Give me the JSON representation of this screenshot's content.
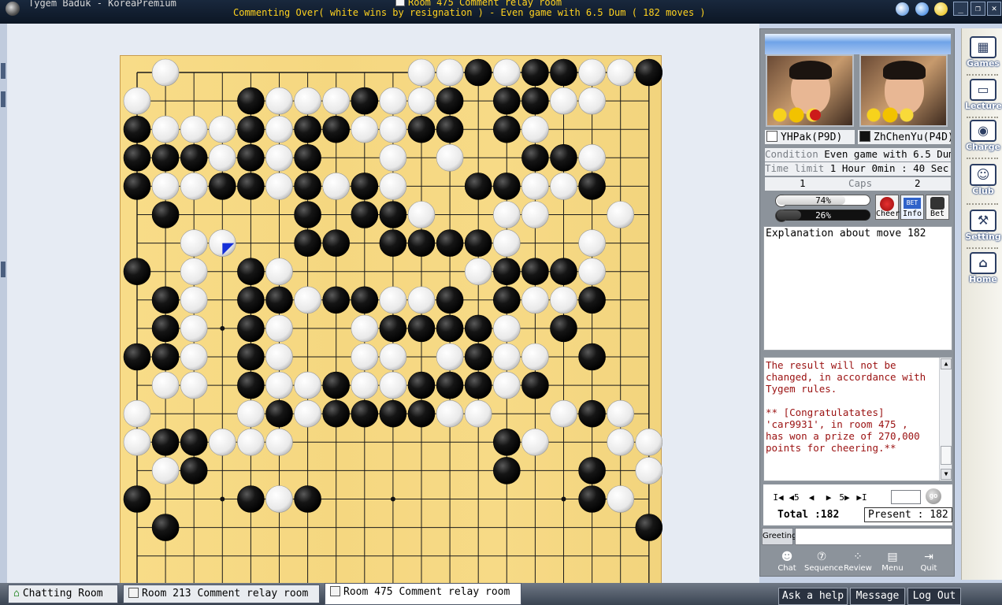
{
  "window": {
    "app_title": "Tygem Baduk - KoreaPremium",
    "room_title": "Room 475 Comment relay room",
    "status": "Commenting Over( white wins by resignation ) - Even game with 6.5 Dum  ( 182 moves )"
  },
  "colors": {
    "board": "#f5d780",
    "title_text": "#ffd21f",
    "chat_text": "#9a1010",
    "last_move_marker": "#1530d8"
  },
  "board": {
    "size": 19,
    "last_move": [
      3,
      6
    ],
    "rows": [
      ".W........WWBWBBWWBW",
      "W...BWWWBWWB.BBWW..",
      "BWWWBWBBWWBB.BW....",
      "BBBWBWB..W.W..BBW..",
      "BWWBBWBWBW..BBWWB..",
      ".B....B.BBW..WW..W.",
      "..WW..BB.BBBBW..W..",
      "B.W.BW......WBBBW..",
      ".BW.BBWBBWWB.BWWB..",
      ".BW.BW..WBBBBW.B...",
      "BBW.BW..WW.WBWW.B..",
      ".WW.BWWBWWBBBWB....",
      "W...WBWBBBBWW..WBW.",
      "WBBWWW.......BW..WWB",
      ".WB..........B..B.WW",
      "B...BWB.........BW..",
      ".B................BB",
      "...................",
      "..................."
    ]
  },
  "players": {
    "white": {
      "name": "YHPak(P9D)"
    },
    "black": {
      "name": "ZhChenYu(P4D)"
    }
  },
  "game_info": {
    "condition_label": "Condition",
    "condition_value": "Even game with 6.5 Dum",
    "time_label": "Time limit",
    "time_value": "1 Hour 0min : 40 Sec / 3 times",
    "caps_label": "Caps",
    "caps_white": "1",
    "caps_black": "2"
  },
  "cheer": {
    "white_pct": 74,
    "black_pct": 26,
    "white_label": "74%",
    "black_label": "26%",
    "cheer_label": "Cheer",
    "info_label": "Info",
    "bet_label": "Bet",
    "bet_badge": "BET"
  },
  "explanation": "Explanation about move 182",
  "chat": "The result will not be\nchanged, in accordance with\nTygem rules.\n\n** [Congratulatates]\n'car9931', in room 475 ,\nhas won a prize of 270,000\npoints for cheering.**",
  "navigation": {
    "first": "I◀",
    "back5": "◀5",
    "back": "◀",
    "forward": "▶",
    "forward5": "5▶",
    "last": "▶I",
    "go_label": "go",
    "total_label": "Total :182",
    "present_label": "Present : 182"
  },
  "greeting": {
    "button": "Greeting"
  },
  "tools": [
    "Chat",
    "Sequence",
    "Review",
    "Menu",
    "Quit"
  ],
  "sidebar": [
    "Games",
    "Lecture",
    "Charge",
    "Club",
    "Setting",
    "Home"
  ],
  "taskbar": {
    "tabs": [
      "Chatting Room",
      "Room 213 Comment relay room",
      "Room 475 Comment relay room"
    ],
    "buttons": [
      "Ask a help",
      "Message",
      "Log Out"
    ]
  }
}
